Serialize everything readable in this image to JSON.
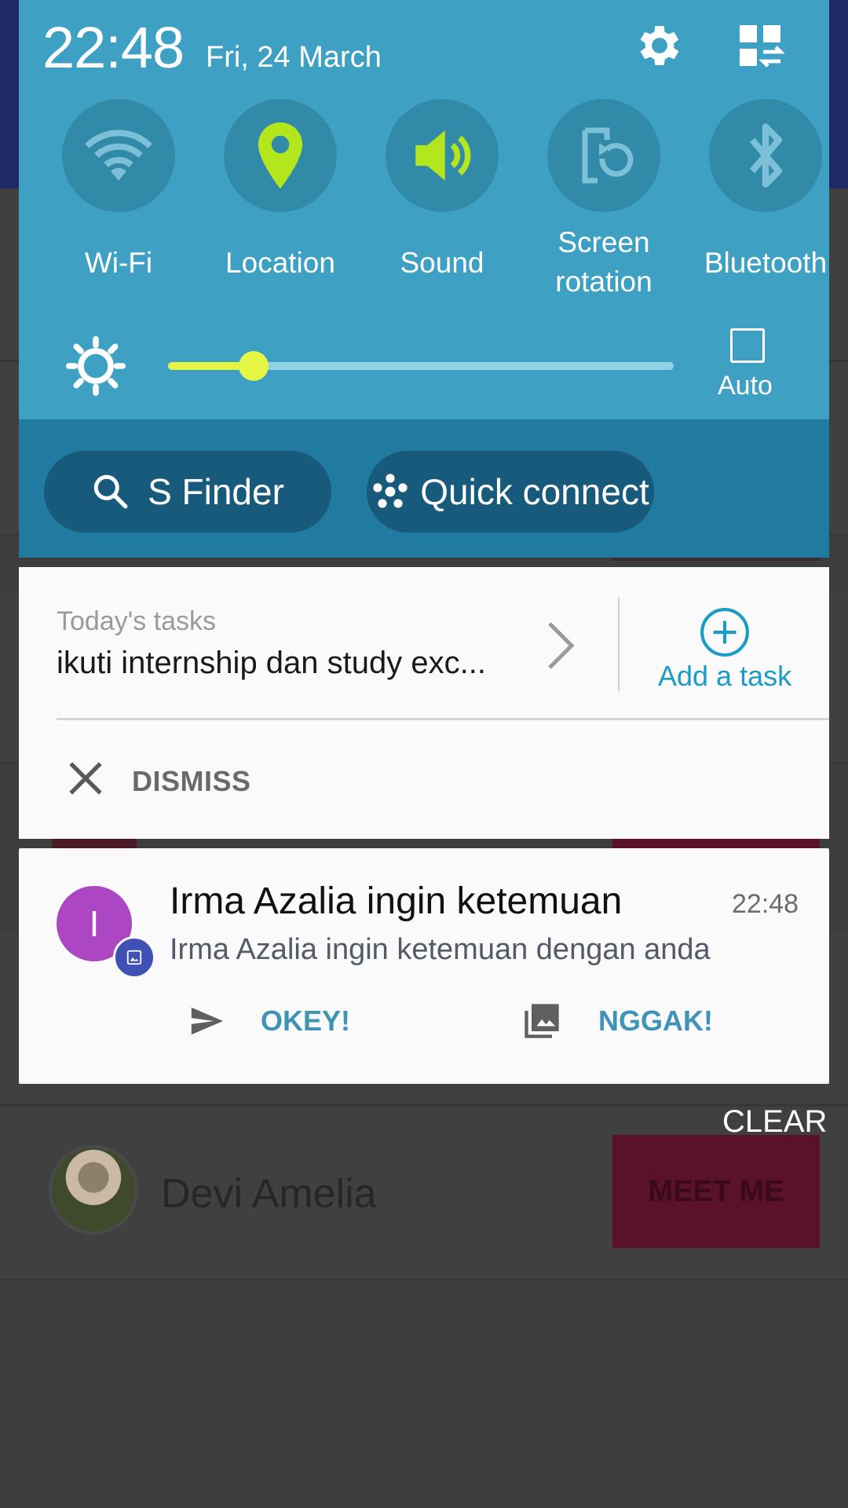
{
  "status": {
    "time": "22:48",
    "date": "Fri, 24 March",
    "settings_icon": "gear-icon",
    "edit_icon": "edit-grid-icon"
  },
  "quick_toggles": [
    {
      "label": "Wi-Fi",
      "icon": "wifi-icon",
      "active": false
    },
    {
      "label": "Location",
      "icon": "location-pin-icon",
      "active": true
    },
    {
      "label": "Sound",
      "icon": "sound-icon",
      "active": true
    },
    {
      "label": "Screen rotation",
      "icon": "screen-rotation-icon",
      "active": false
    },
    {
      "label": "Bluetooth",
      "icon": "bluetooth-icon",
      "active": false
    }
  ],
  "brightness": {
    "level": 0.17,
    "auto_label": "Auto",
    "auto_checked": false
  },
  "panel_buttons": {
    "s_finder": "S Finder",
    "quick_connect": "Quick connect"
  },
  "tasks": {
    "header": "Today's tasks",
    "text": "ikuti internship dan study exc...",
    "add_label": "Add a task",
    "dismiss_label": "DISMISS"
  },
  "notification": {
    "avatar_letter": "I",
    "title": "Irma Azalia ingin ketemuan",
    "time": "22:48",
    "body": "Irma Azalia ingin ketemuan dengan anda",
    "action_yes": "OKEY!",
    "action_no": "NGGAK!"
  },
  "clear_label": "CLEAR",
  "background_app": {
    "name": "Devi Amelia",
    "button": "MEET ME"
  },
  "colors": {
    "panel": "#3ea1c4",
    "panel_dark": "#217aa0",
    "accent_green": "#b4e61e",
    "slider": "#e6f542",
    "link_blue": "#1a9cc7",
    "avatar_purple": "#ad46c3"
  }
}
